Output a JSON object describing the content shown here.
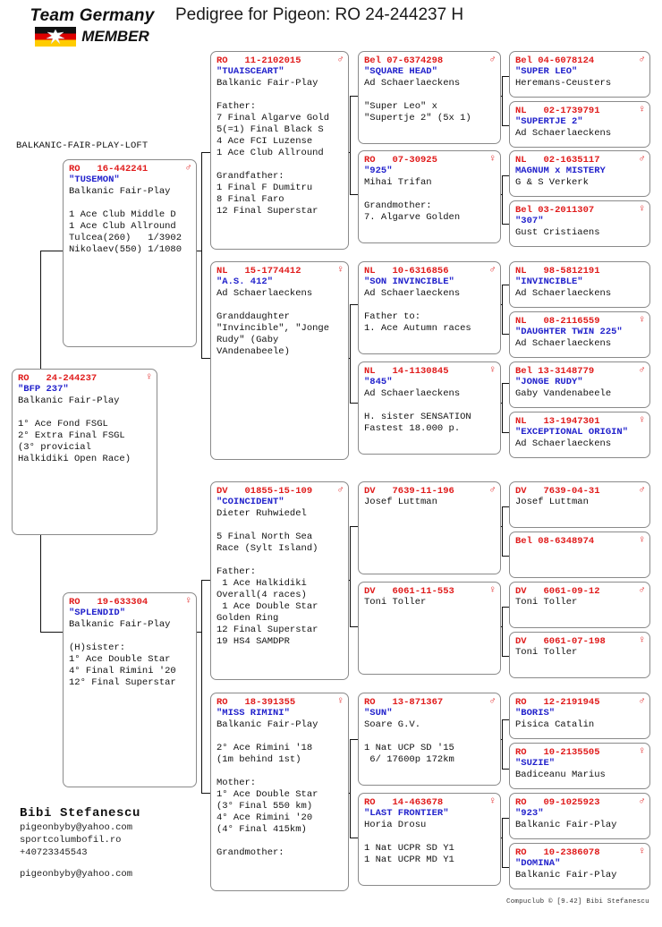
{
  "header": {
    "logo_line1": "Team Germany",
    "logo_line2": "MEMBER",
    "title": "Pedigree for Pigeon: RO  24-244237 H"
  },
  "loft_label": "BALKANIC-FAIR-PLAY-LOFT",
  "icons": {
    "male": "♂",
    "female": "♀"
  },
  "subject": {
    "reg": "RO   24-244237",
    "sex": "female",
    "name": "\"BFP 237\"",
    "lines": [
      "Balkanic Fair-Play",
      "",
      "1° Ace Fond FSGL",
      "2° Extra Final FSGL",
      "(3° provicial",
      "Halkidiki Open Race)"
    ]
  },
  "gen1": [
    {
      "reg": "RO   16-442241",
      "sex": "male",
      "name": "\"TUSEMON\"",
      "lines": [
        "Balkanic Fair-Play",
        "",
        "1 Ace Club Middle D",
        "1 Ace Club Allround",
        "Tulcea(260)   1/3902",
        "Nikolaev(550) 1/1080"
      ]
    },
    {
      "reg": "RO   19-633304",
      "sex": "female",
      "name": "\"SPLENDID\"",
      "lines": [
        "Balkanic Fair-Play",
        "",
        "(H)sister:",
        "1° Ace Double Star",
        "4° Final Rimini '20",
        "12° Final Superstar"
      ]
    }
  ],
  "gen2": [
    {
      "reg": "RO   11-2102015",
      "sex": "male",
      "name": "\"TUAISCEART\"",
      "lines": [
        "Balkanic Fair-Play",
        "",
        "Father:",
        "7 Final Algarve Gold",
        "5(=1) Final Black S",
        "4 Ace FCI Luzense",
        "1 Ace Club Allround",
        "",
        "Grandfather:",
        "1 Final F Dumitru",
        "8 Final Faro",
        "12 Final Superstar"
      ]
    },
    {
      "reg": "NL   15-1774412",
      "sex": "female",
      "name": "\"A.S. 412\"",
      "lines": [
        "Ad Schaerlaeckens",
        "",
        "Granddaughter",
        "\"Invincible\", \"Jonge",
        "Rudy\" (Gaby",
        "VAndenabeele)"
      ]
    },
    {
      "reg": "DV   01855-15-109",
      "sex": "male",
      "name": "\"COINCIDENT\"",
      "lines": [
        "Dieter Ruhwiedel",
        "",
        "5 Final North Sea",
        "Race (Sylt Island)",
        "",
        "Father:",
        " 1 Ace Halkidiki",
        "Overall(4 races)",
        " 1 Ace Double Star",
        "Golden Ring",
        "12 Final Superstar",
        "19 HS4 SAMDPR"
      ]
    },
    {
      "reg": "RO   18-391355",
      "sex": "female",
      "name": "\"MISS RIMINI\"",
      "lines": [
        "Balkanic Fair-Play",
        "",
        "2° Ace Rimini '18",
        "(1m behind 1st)",
        "",
        "Mother:",
        "1° Ace Double Star",
        "(3° Final 550 km)",
        "4° Ace Rimini '20",
        "(4° Final 415km)",
        "",
        "Grandmother:"
      ]
    }
  ],
  "gen3": [
    {
      "reg": "Bel 07-6374298",
      "sex": "male",
      "name": "\"SQUARE HEAD\"",
      "lines": [
        "Ad Schaerlaeckens",
        "",
        "\"Super Leo\" x",
        "\"Supertje 2\" (5x 1)"
      ]
    },
    {
      "reg": "RO   07-30925",
      "sex": "female",
      "name": "\"925\"",
      "lines": [
        "Mihai Trifan",
        "",
        "Grandmother:",
        "7. Algarve Golden"
      ]
    },
    {
      "reg": "NL   10-6316856",
      "sex": "male",
      "name": "\"SON INVINCIBLE\"",
      "lines": [
        "Ad Schaerlaeckens",
        "",
        "Father to:",
        "1. Ace Autumn races"
      ]
    },
    {
      "reg": "NL   14-1130845",
      "sex": "female",
      "name": "\"845\"",
      "lines": [
        "Ad Schaerlaeckens",
        "",
        "H. sister SENSATION",
        "Fastest 18.000 p."
      ]
    },
    {
      "reg": "DV   7639-11-196",
      "sex": "male",
      "name": "",
      "lines": [
        "Josef Luttman"
      ]
    },
    {
      "reg": "DV   6061-11-553",
      "sex": "female",
      "name": "",
      "lines": [
        "Toni Toller"
      ]
    },
    {
      "reg": "RO   13-871367",
      "sex": "male",
      "name": "\"SUN\"",
      "lines": [
        "Soare G.V.",
        "",
        "1 Nat UCP SD '15",
        " 6/ 17600p 172km"
      ]
    },
    {
      "reg": "RO   14-463678",
      "sex": "female",
      "name": "\"LAST FRONTIER\"",
      "lines": [
        "Horia Drosu",
        "",
        "1 Nat UCPR SD Y1",
        "1 Nat UCPR MD Y1"
      ]
    }
  ],
  "gen4": [
    {
      "reg": "Bel 04-6078124",
      "sex": "male",
      "name": "\"SUPER LEO\"",
      "lines": [
        "Heremans-Ceusters"
      ]
    },
    {
      "reg": "NL   02-1739791",
      "sex": "female",
      "name": "\"SUPERTJE 2\"",
      "lines": [
        "Ad Schaerlaeckens"
      ]
    },
    {
      "reg": "NL   02-1635117",
      "sex": "male",
      "name": "MAGNUM x MISTERY",
      "lines": [
        "G & S Verkerk"
      ]
    },
    {
      "reg": "Bel 03-2011307",
      "sex": "female",
      "name": "\"307\"",
      "lines": [
        "Gust Cristiaens"
      ]
    },
    {
      "reg": "NL   98-5812191",
      "sex": "",
      "name": "\"INVINCIBLE\"",
      "lines": [
        "Ad Schaerlaeckens"
      ]
    },
    {
      "reg": "NL   08-2116559",
      "sex": "female",
      "name": "\"DAUGHTER TWIN 225\"",
      "lines": [
        "Ad Schaerlaeckens"
      ]
    },
    {
      "reg": "Bel 13-3148779",
      "sex": "male",
      "name": "\"JONGE RUDY\"",
      "lines": [
        "Gaby Vandenabeele"
      ]
    },
    {
      "reg": "NL   13-1947301",
      "sex": "female",
      "name": "\"EXCEPTIONAL ORIGIN\"",
      "lines": [
        "Ad Schaerlaeckens"
      ]
    },
    {
      "reg": "DV   7639-04-31",
      "sex": "male",
      "name": "",
      "lines": [
        "Josef Luttman"
      ]
    },
    {
      "reg": "Bel 08-6348974",
      "sex": "female",
      "name": "",
      "lines": []
    },
    {
      "reg": "DV   6061-09-12",
      "sex": "male",
      "name": "",
      "lines": [
        "Toni Toller"
      ]
    },
    {
      "reg": "DV   6061-07-198",
      "sex": "female",
      "name": "",
      "lines": [
        "Toni Toller"
      ]
    },
    {
      "reg": "RO   12-2191945",
      "sex": "male",
      "name": "\"BORIS\"",
      "lines": [
        "Pisica Catalin"
      ]
    },
    {
      "reg": "RO   10-2135505",
      "sex": "female",
      "name": "\"SUZIE\"",
      "lines": [
        "Badiceanu Marius"
      ]
    },
    {
      "reg": "RO   09-1025923",
      "sex": "male",
      "name": "\"923\"",
      "lines": [
        "Balkanic Fair-Play"
      ]
    },
    {
      "reg": "RO   10-2386078",
      "sex": "female",
      "name": "\"DOMINA\"",
      "lines": [
        "Balkanic Fair-Play"
      ]
    }
  ],
  "owner": {
    "name": "Bibi Stefanescu",
    "email": "pigeonbyby@yahoo.com",
    "site": "sportcolumbofil.ro",
    "phone": "+40723345543",
    "email2": "pigeonbyby@yahoo.com"
  },
  "credit": "Compuclub © [9.42]  Bibi Stefanescu",
  "colors": {
    "reg": "#e01b1b",
    "name": "#2222cc",
    "box_border": "#8a8a8a"
  }
}
